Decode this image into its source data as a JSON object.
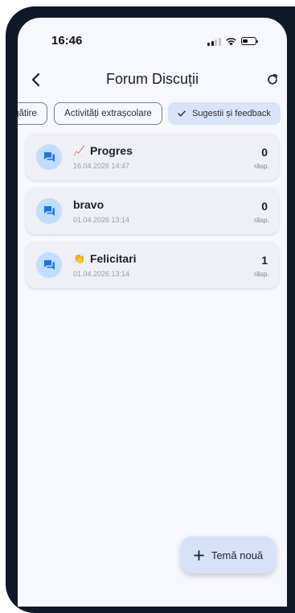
{
  "status_bar": {
    "time": "16:46",
    "icons": [
      "signal-icon",
      "wifi-icon",
      "battery-icon"
    ]
  },
  "app_bar": {
    "title": "Forum Discuții",
    "back_icon": "chevron-left-icon",
    "refresh_icon": "refresh-icon"
  },
  "filter_chips": [
    {
      "label": "gătire",
      "selected": false
    },
    {
      "label": "Activități extrașcolare",
      "selected": false
    },
    {
      "label": "Sugestii și feedback",
      "selected": true,
      "icon": "check-icon"
    }
  ],
  "topics": [
    {
      "emoji": "📈",
      "title": "Progres",
      "date": "16.04.2026 14:47",
      "reply_count": "0",
      "reply_label": "răsp.",
      "icon": "forum-icon"
    },
    {
      "emoji": "",
      "title": "bravo",
      "date": "01.04.2026 13:14",
      "reply_count": "0",
      "reply_label": "răsp.",
      "icon": "forum-icon"
    },
    {
      "emoji": "👏",
      "title": "Felicitari",
      "date": "01.04.2026 13:14",
      "reply_count": "1",
      "reply_label": "răsp.",
      "icon": "forum-icon"
    }
  ],
  "fab": {
    "label": "Temă nouă",
    "icon": "plus-icon"
  },
  "colors": {
    "background": "#f7f8fd",
    "card": "#eef0f6",
    "avatar": "#c1ddff",
    "accent": "#1a73e8",
    "selected_chip": "#dbe3f7",
    "fab": "#d7e1f7",
    "frame": "#101727"
  }
}
